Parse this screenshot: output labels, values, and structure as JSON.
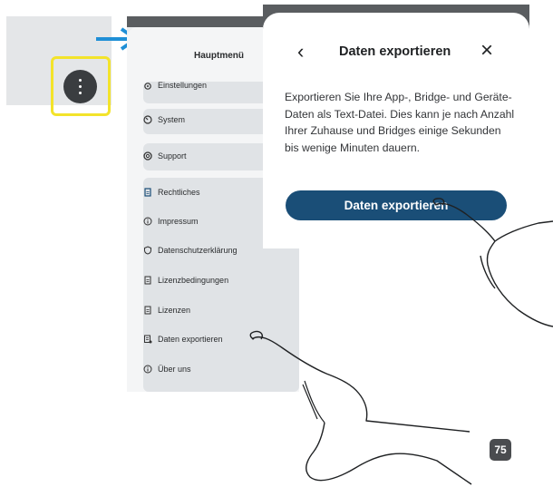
{
  "menu": {
    "title": "Hauptmenü",
    "items": [
      {
        "label": "Einstellungen",
        "icon": "gear-icon"
      },
      {
        "label": "System",
        "icon": "dial-icon"
      },
      {
        "label": "Support",
        "icon": "lifebuoy-icon"
      },
      {
        "label": "Rechtliches",
        "icon": "document-icon"
      },
      {
        "label": "Impressum",
        "icon": "info-icon"
      },
      {
        "label": "Datenschutzerklärung",
        "icon": "shield-icon"
      },
      {
        "label": "Lizenzbedingungen",
        "icon": "document-icon"
      },
      {
        "label": "Lizenzen",
        "icon": "document-icon"
      },
      {
        "label": "Daten exportieren",
        "icon": "export-icon"
      },
      {
        "label": "Über uns",
        "icon": "info-icon"
      }
    ]
  },
  "dialog": {
    "title": "Daten exportieren",
    "description": "Exportieren Sie Ihre App-, Bridge- und Geräte-Daten als Text-Datei. Dies kann je nach Anzahl Ihrer Zuhause und Bridges einige Sekunden bis wenige Minuten dauern.",
    "button_label": "Daten exportieren"
  },
  "page_number": "75",
  "colors": {
    "accent": "#1a4e77",
    "highlight": "#f3e32a",
    "arrow": "#1f8fd6"
  }
}
